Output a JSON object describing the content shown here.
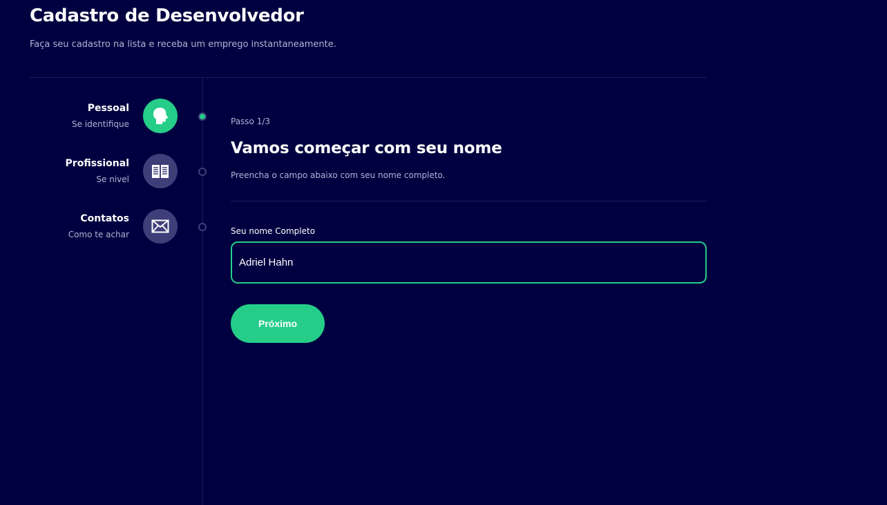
{
  "header": {
    "title": "Cadastro de Desenvolvedor",
    "subtitle": "Faça seu cadastro na lista e receba um emprego instantaneamente."
  },
  "steps": [
    {
      "title": "Pessoal",
      "description": "Se identifique",
      "icon": "person-head-icon",
      "active": true
    },
    {
      "title": "Profissional",
      "description": "Se nivel",
      "icon": "book-icon",
      "active": false
    },
    {
      "title": "Contatos",
      "description": "Como te achar",
      "icon": "mail-icon",
      "active": false
    }
  ],
  "main": {
    "step_count": "Passo 1/3",
    "heading": "Vamos começar com seu nome",
    "description": "Preencha o campo abaixo com seu nome completo.",
    "field_label": "Seu nome Completo",
    "name_value": "Adriel Hahn",
    "next_button": "Próximo"
  },
  "colors": {
    "background": "#000040",
    "accent": "#25cd89",
    "inactive": "#3e3e78",
    "divider": "#1c1c5a",
    "muted_text": "#b4b4d6"
  }
}
